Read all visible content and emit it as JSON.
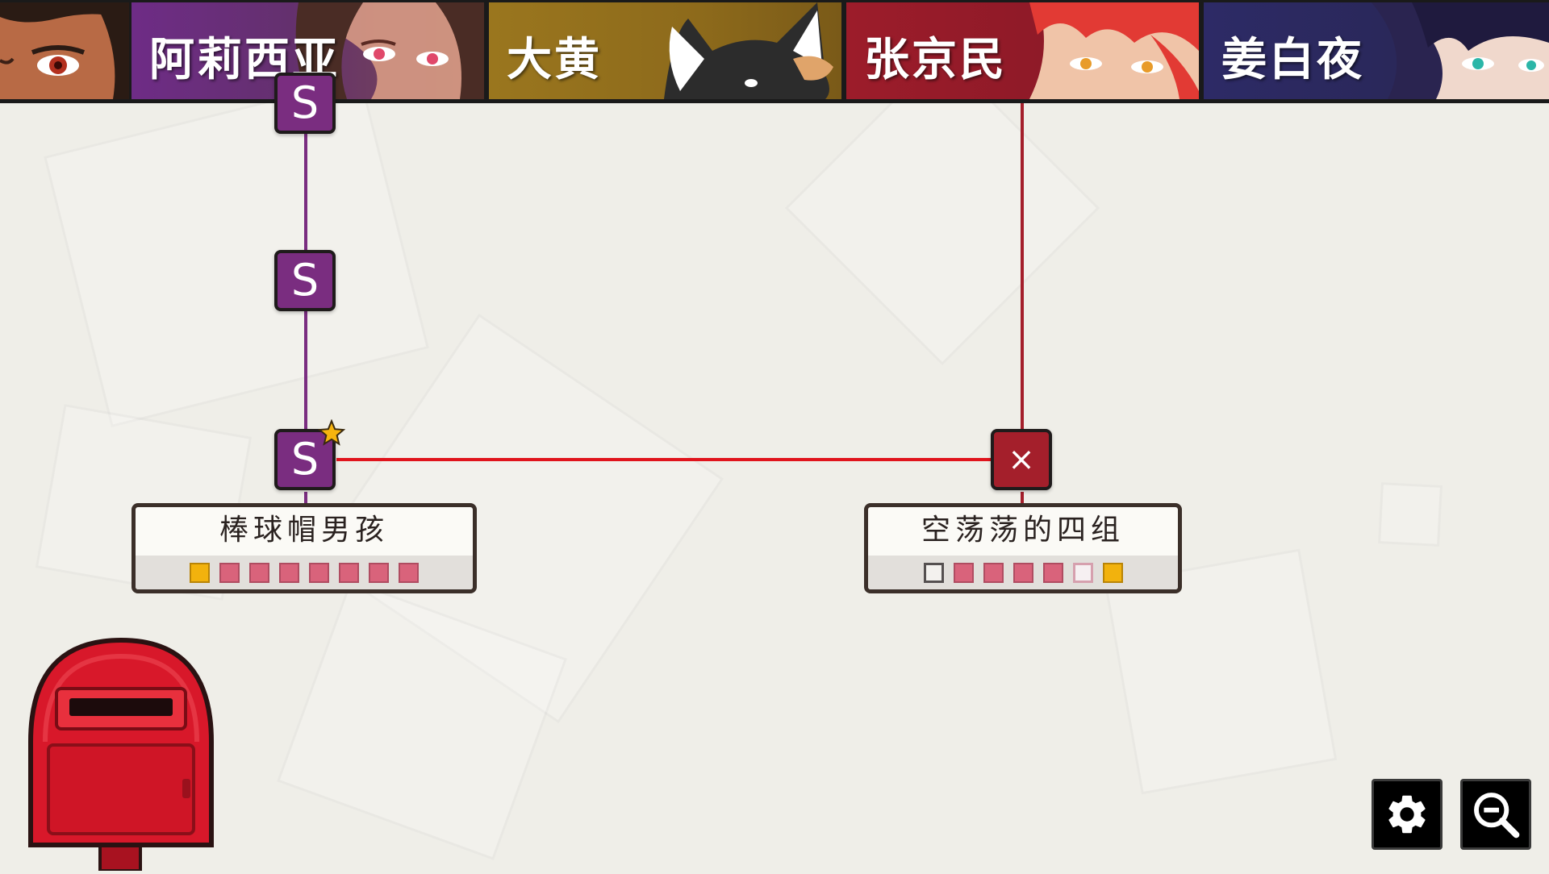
{
  "tabs": [
    {
      "id": "left",
      "name": ""
    },
    {
      "id": "alicia",
      "name": "阿莉西亚"
    },
    {
      "id": "dahuang",
      "name": "大黄"
    },
    {
      "id": "zhang",
      "name": "张京民"
    },
    {
      "id": "jiang",
      "name": "姜白夜"
    }
  ],
  "graph": {
    "nodes": [
      {
        "id": "s-top",
        "label": "S"
      },
      {
        "id": "s-mid",
        "label": "S"
      },
      {
        "id": "s-star",
        "label": "S",
        "starred": true
      },
      {
        "id": "x-node",
        "label": "×"
      }
    ],
    "chapters": [
      {
        "title": "棒球帽男孩",
        "squares": [
          "gold",
          "pink",
          "pink",
          "pink",
          "pink",
          "pink",
          "pink",
          "pink"
        ]
      },
      {
        "title": "空荡荡的四组",
        "squares": [
          "empty",
          "pink",
          "pink",
          "pink",
          "pink",
          "light",
          "gold"
        ]
      }
    ]
  },
  "colors": {
    "line_purple": "#7a2d80",
    "line_red": "#e0141c",
    "line_dark_red": "#a41f2b",
    "accent_gold": "#f2b20d",
    "mailbox_red": "#d8182a"
  },
  "icons": {
    "settings": "gear-icon",
    "zoom": "zoom-out-icon",
    "mailbox": "mailbox-icon",
    "star": "star-icon"
  }
}
